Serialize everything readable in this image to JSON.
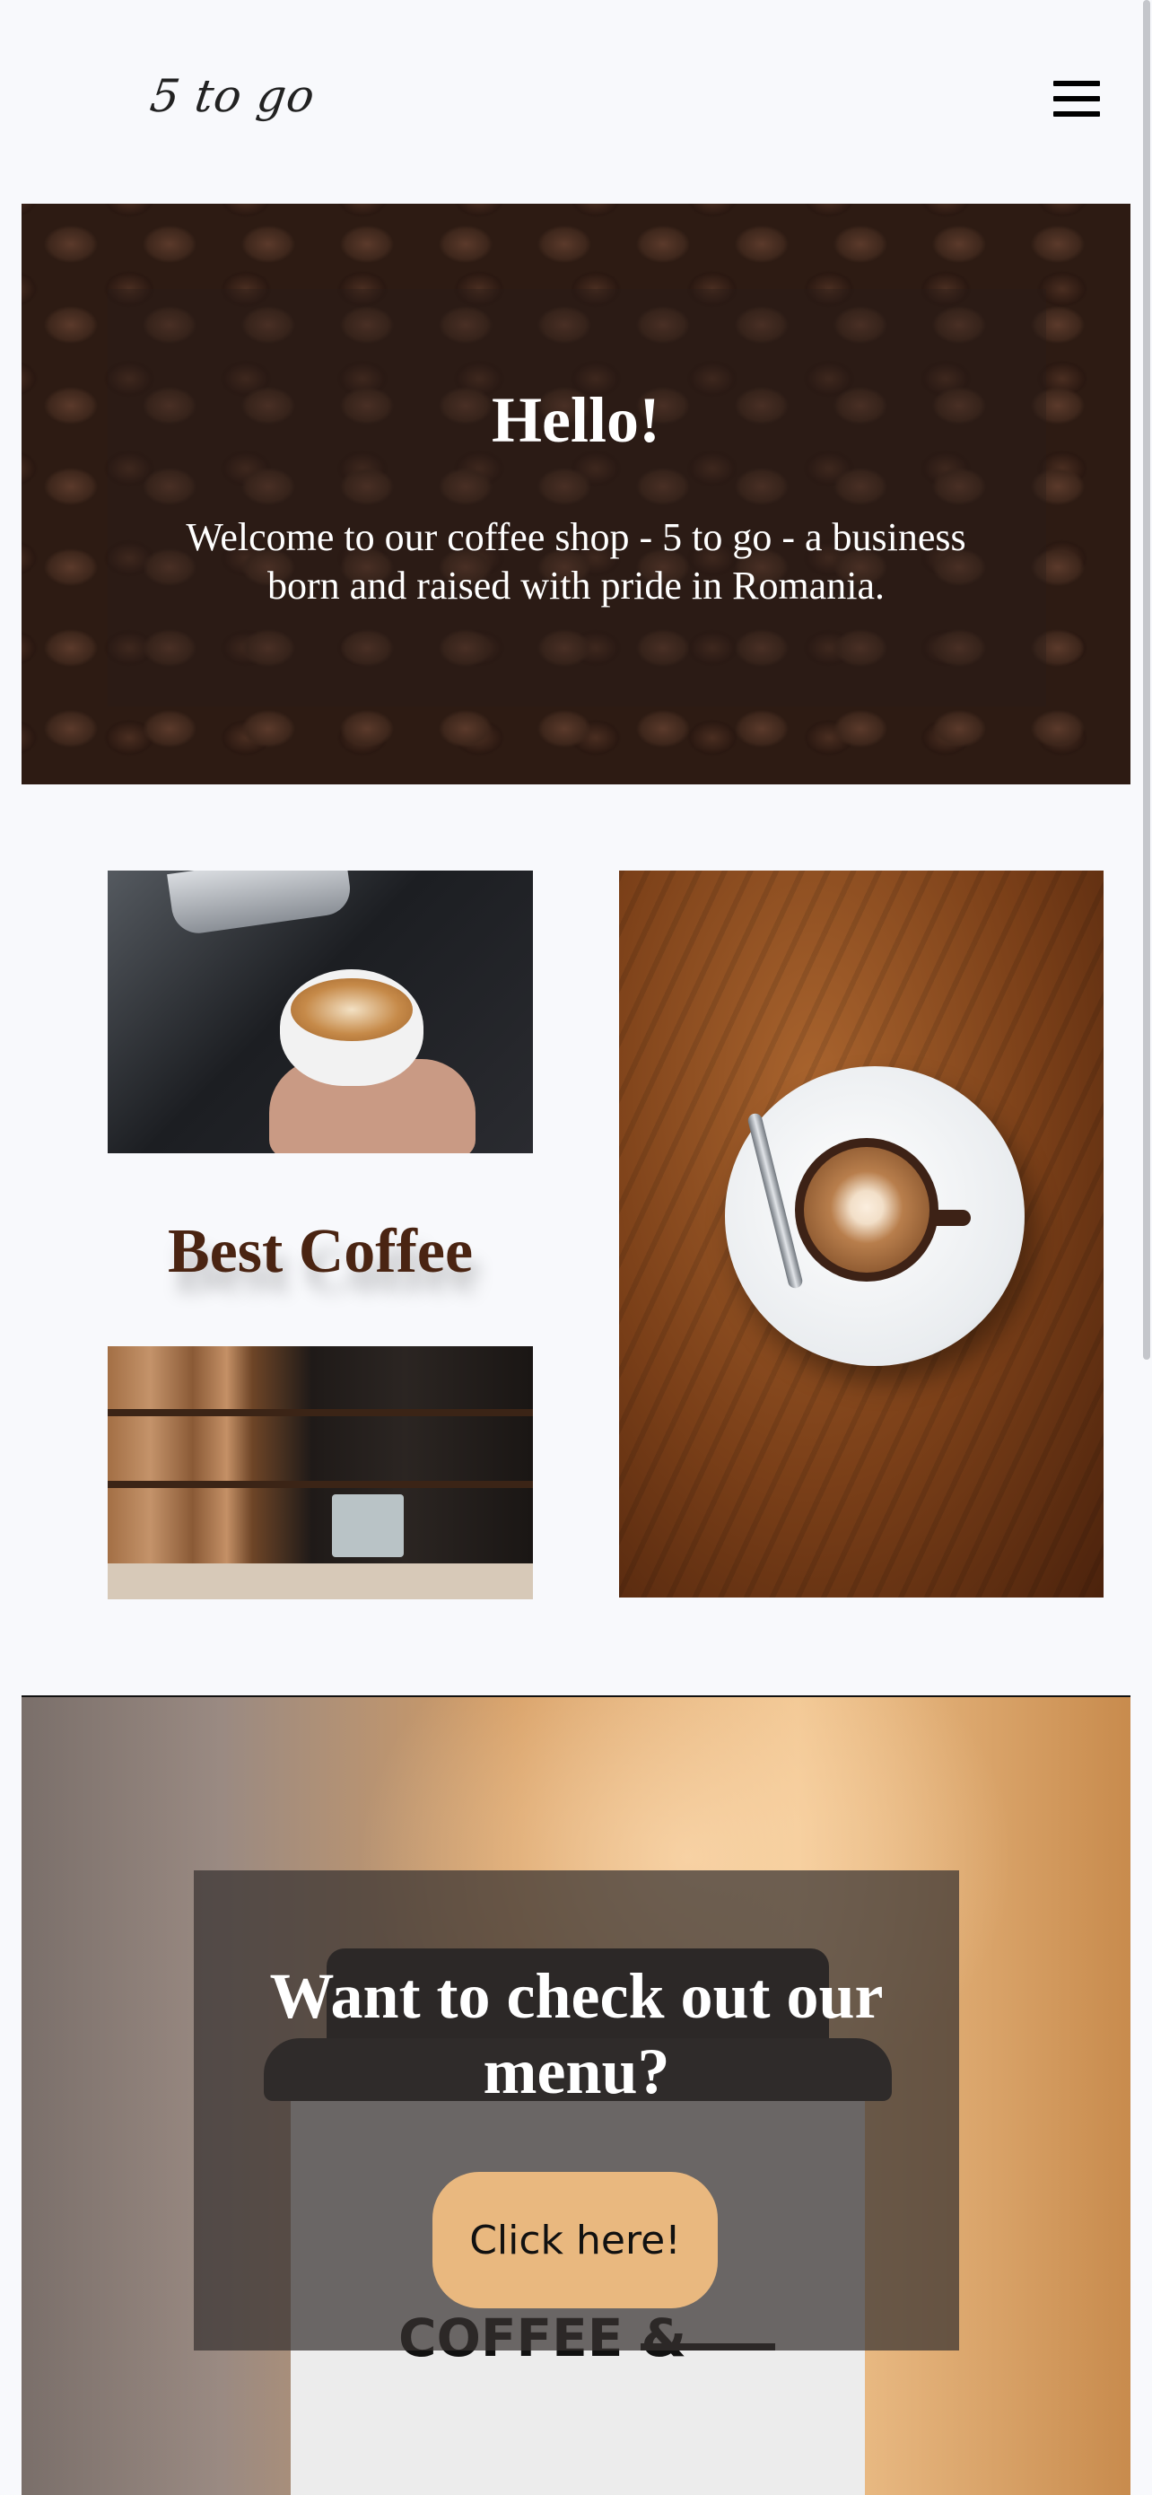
{
  "header": {
    "logo_text": "5 to go",
    "menu_icon": "hamburger-menu-icon"
  },
  "hero": {
    "title": "Hello!",
    "text": "Welcome to our coffee shop - 5 to go - a business born and raised with pride in Romania."
  },
  "gallery": {
    "heading": "Best Coffee"
  },
  "cta": {
    "title": "Want to check out our menu?",
    "button_label": "Click here!",
    "cup_print": "COFFEE &"
  },
  "colors": {
    "background": "#f8f9fc",
    "heading_brown": "#4a2412",
    "button": "#e9b87f"
  }
}
